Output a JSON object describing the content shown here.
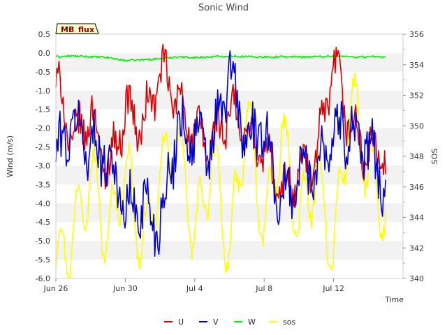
{
  "chart_data": {
    "type": "line",
    "title": "Sonic Wind",
    "site_label": "MB_flux",
    "xlabel": "Time",
    "ylabel": "Wind (m/s)",
    "y2label": "SOS",
    "x_start": "2024-06-26",
    "x_end": "2024-07-15",
    "xlim": [
      "2024-06-26",
      "2024-07-16"
    ],
    "ylim": [
      -6.0,
      0.5
    ],
    "y2lim": [
      340,
      356
    ],
    "x_ticks": [
      "Jun 26",
      "Jun 30",
      "Jul 4",
      "Jul 8",
      "Jul 12"
    ],
    "y_ticks": [
      "0.5",
      "0.0",
      "-0.5",
      "-1.0",
      "-1.5",
      "-2.0",
      "-2.5",
      "-3.0",
      "-3.5",
      "-4.0",
      "-4.5",
      "-5.0",
      "-5.5",
      "-6.0"
    ],
    "y2_ticks": [
      "356",
      "354",
      "352",
      "350",
      "348",
      "346",
      "344",
      "342",
      "340"
    ],
    "legend_position": "bottom-center",
    "grid": "horizontal bands",
    "series": [
      {
        "name": "U",
        "color": "#dd0000",
        "axis": "left",
        "x": [
          "2024-06-26",
          "2024-06-27",
          "2024-06-28",
          "2024-06-29",
          "2024-06-30",
          "2024-07-01",
          "2024-07-02",
          "2024-07-03",
          "2024-07-04",
          "2024-07-05",
          "2024-07-06",
          "2024-07-07",
          "2024-07-08",
          "2024-07-09",
          "2024-07-10",
          "2024-07-11",
          "2024-07-12",
          "2024-07-13",
          "2024-07-14",
          "2024-07-15"
        ],
        "values": [
          -0.8,
          -2.4,
          -1.6,
          -3.2,
          -1.5,
          -2.0,
          -0.5,
          -1.2,
          -2.2,
          -2.4,
          -1.6,
          -2.1,
          -2.7,
          -3.7,
          -3.2,
          -2.9,
          -0.3,
          -2.0,
          -2.7,
          -2.8
        ]
      },
      {
        "name": "V",
        "color": "#0000cc",
        "axis": "left",
        "x": [
          "2024-06-26",
          "2024-06-27",
          "2024-06-28",
          "2024-06-29",
          "2024-06-30",
          "2024-07-01",
          "2024-07-02",
          "2024-07-03",
          "2024-07-04",
          "2024-07-05",
          "2024-07-06",
          "2024-07-07",
          "2024-07-08",
          "2024-07-09",
          "2024-07-10",
          "2024-07-11",
          "2024-07-12",
          "2024-07-13",
          "2024-07-14",
          "2024-07-15"
        ],
        "values": [
          -2.8,
          -1.9,
          -2.5,
          -2.7,
          -4.2,
          -4.0,
          -4.6,
          -2.0,
          -2.3,
          -2.6,
          -0.5,
          -2.4,
          -2.0,
          -4.1,
          -3.2,
          -3.0,
          -2.1,
          -2.0,
          -2.6,
          -3.5
        ]
      },
      {
        "name": "W",
        "color": "#00ee00",
        "axis": "left",
        "x": [
          "2024-06-26",
          "2024-06-27",
          "2024-06-28",
          "2024-06-29",
          "2024-06-30",
          "2024-07-01",
          "2024-07-02",
          "2024-07-03",
          "2024-07-04",
          "2024-07-05",
          "2024-07-06",
          "2024-07-07",
          "2024-07-08",
          "2024-07-09",
          "2024-07-10",
          "2024-07-11",
          "2024-07-12",
          "2024-07-13",
          "2024-07-14",
          "2024-07-15"
        ],
        "values": [
          -0.1,
          -0.08,
          -0.1,
          -0.12,
          -0.2,
          -0.18,
          -0.15,
          -0.1,
          -0.12,
          -0.1,
          -0.08,
          -0.1,
          -0.1,
          -0.1,
          -0.1,
          -0.1,
          -0.08,
          -0.1,
          -0.1,
          -0.1
        ]
      },
      {
        "name": "sos",
        "color": "#ffff00",
        "axis": "right",
        "x": [
          "2024-06-26",
          "2024-06-27",
          "2024-06-28",
          "2024-06-29",
          "2024-06-30",
          "2024-07-01",
          "2024-07-02",
          "2024-07-03",
          "2024-07-04",
          "2024-07-05",
          "2024-07-06",
          "2024-07-07",
          "2024-07-08",
          "2024-07-09",
          "2024-07-10",
          "2024-07-11",
          "2024-07-12",
          "2024-07-13",
          "2024-07-14",
          "2024-07-15"
        ],
        "values": [
          341,
          343,
          347,
          342.5,
          347.5,
          342,
          346.5,
          349.5,
          342.5,
          348,
          341.5,
          351,
          343,
          349.5,
          343.5,
          347,
          341.5,
          352,
          347,
          344
        ]
      }
    ]
  }
}
